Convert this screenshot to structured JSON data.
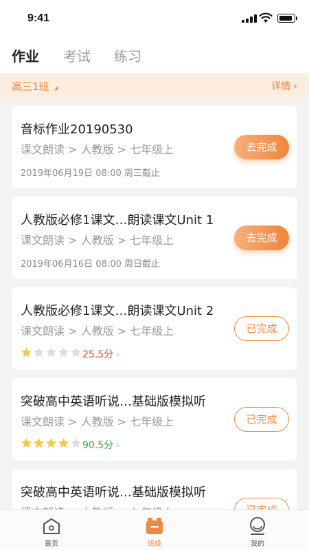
{
  "status": {
    "time": "9:41"
  },
  "tabs": [
    {
      "label": "作业",
      "active": true
    },
    {
      "label": "考试",
      "active": false
    },
    {
      "label": "练习",
      "active": false
    }
  ],
  "class_bar": {
    "class_name": "高三1班",
    "details_label": "详情",
    "accent": "#f0883d"
  },
  "homework": [
    {
      "title": "音标作业20190530",
      "path": "课文朗读 > 人教版 > 七年级上",
      "deadline": "2019年06月19日  08:00  周三截止",
      "action": "去完成",
      "status": "todo"
    },
    {
      "title": "人教版必修1课文…朗读课文Unit 1",
      "path": "课文朗读 > 人教版 > 七年级上",
      "deadline": "2019年06月16日  08:00  周日截止",
      "action": "去完成",
      "status": "todo"
    },
    {
      "title": "人教版必修1课文…朗读课文Unit 2",
      "path": "课文朗读 > 人教版 > 七年级上",
      "action": "已完成",
      "status": "done",
      "stars": 1,
      "score": "25.5分",
      "score_color": "#e0443a"
    },
    {
      "title": "突破高中英语听说…基础版模拟听",
      "path": "课文朗读 > 人教版 > 七年级上",
      "action": "已完成",
      "status": "done",
      "stars": 4,
      "score": "90.5分",
      "score_color": "#2fa84f"
    },
    {
      "title": "突破高中英语听说…基础版模拟听",
      "path": "课文朗读 > 人教版 > 七年级上",
      "action": "已完成",
      "status": "done"
    }
  ],
  "bottom_nav": [
    {
      "label": "首页",
      "icon": "home-icon",
      "active": false
    },
    {
      "label": "班级",
      "icon": "class-icon",
      "active": true
    },
    {
      "label": "我的",
      "icon": "profile-icon",
      "active": false
    }
  ]
}
